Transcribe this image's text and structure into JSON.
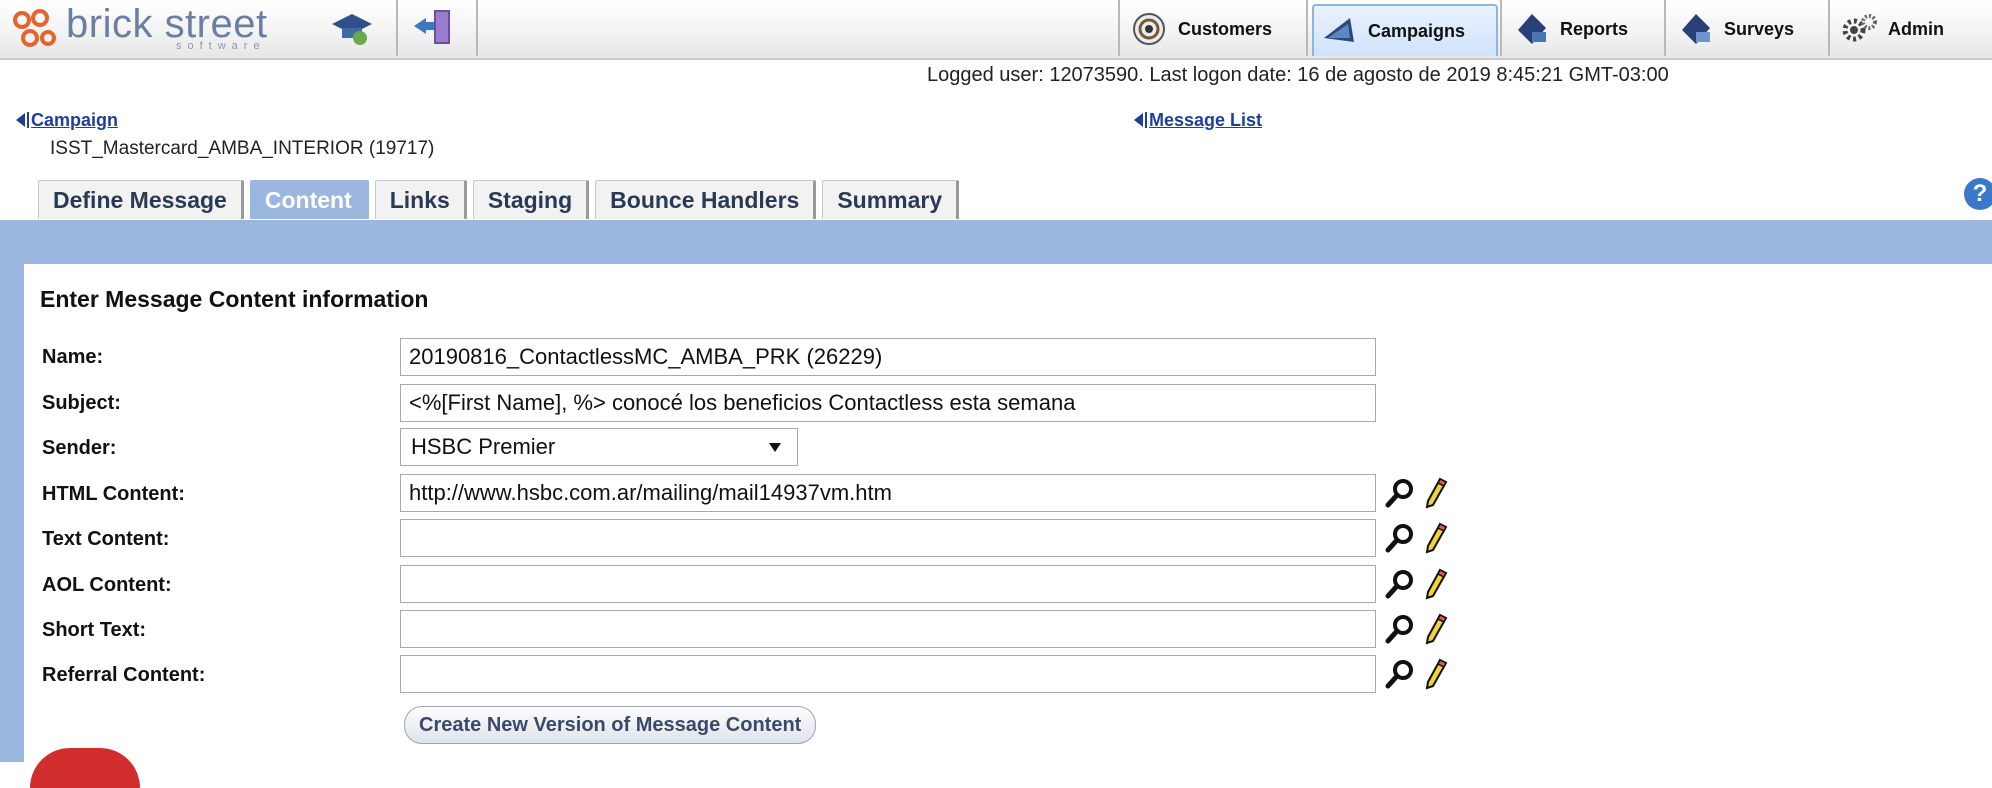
{
  "brand": {
    "name": "brick street",
    "tagline": "software"
  },
  "nav": {
    "customers": "Customers",
    "campaigns": "Campaigns",
    "reports": "Reports",
    "surveys": "Surveys",
    "admin": "Admin"
  },
  "session": {
    "logged_text": "Logged user: 12073590. Last logon date: 16 de agosto de 2019 8:45:21 GMT-03:00"
  },
  "breadcrumbs": {
    "campaign": "Campaign",
    "campaign_name": "ISST_Mastercard_AMBA_INTERIOR (19717)",
    "message_list": "Message List"
  },
  "tabs": [
    "Define Message",
    "Content",
    "Links",
    "Staging",
    "Bounce Handlers",
    "Summary"
  ],
  "form": {
    "heading": "Enter Message Content information",
    "name_label": "Name:",
    "name_value": "20190816_ContactlessMC_AMBA_PRK (26229)",
    "subject_label": "Subject:",
    "subject_value": "<%[First Name], %> conocé los beneficios Contactless esta semana",
    "sender_label": "Sender:",
    "sender_value": "HSBC Premier",
    "html_label": "HTML Content:",
    "html_value": "http://www.hsbc.com.ar/mailing/mail14937vm.htm",
    "text_label": "Text Content:",
    "text_value": "",
    "aol_label": "AOL Content:",
    "aol_value": "",
    "short_label": "Short Text:",
    "short_value": "",
    "referral_label": "Referral Content:",
    "referral_value": "",
    "create_button": "Create New Version of Message Content"
  },
  "icons": {
    "search": "magnifier-icon",
    "edit": "pencil-icon",
    "help": "help-icon"
  },
  "colors": {
    "panel": "#9bb7e0",
    "link": "#1e3f9a",
    "accent_red": "#d22d2d"
  }
}
